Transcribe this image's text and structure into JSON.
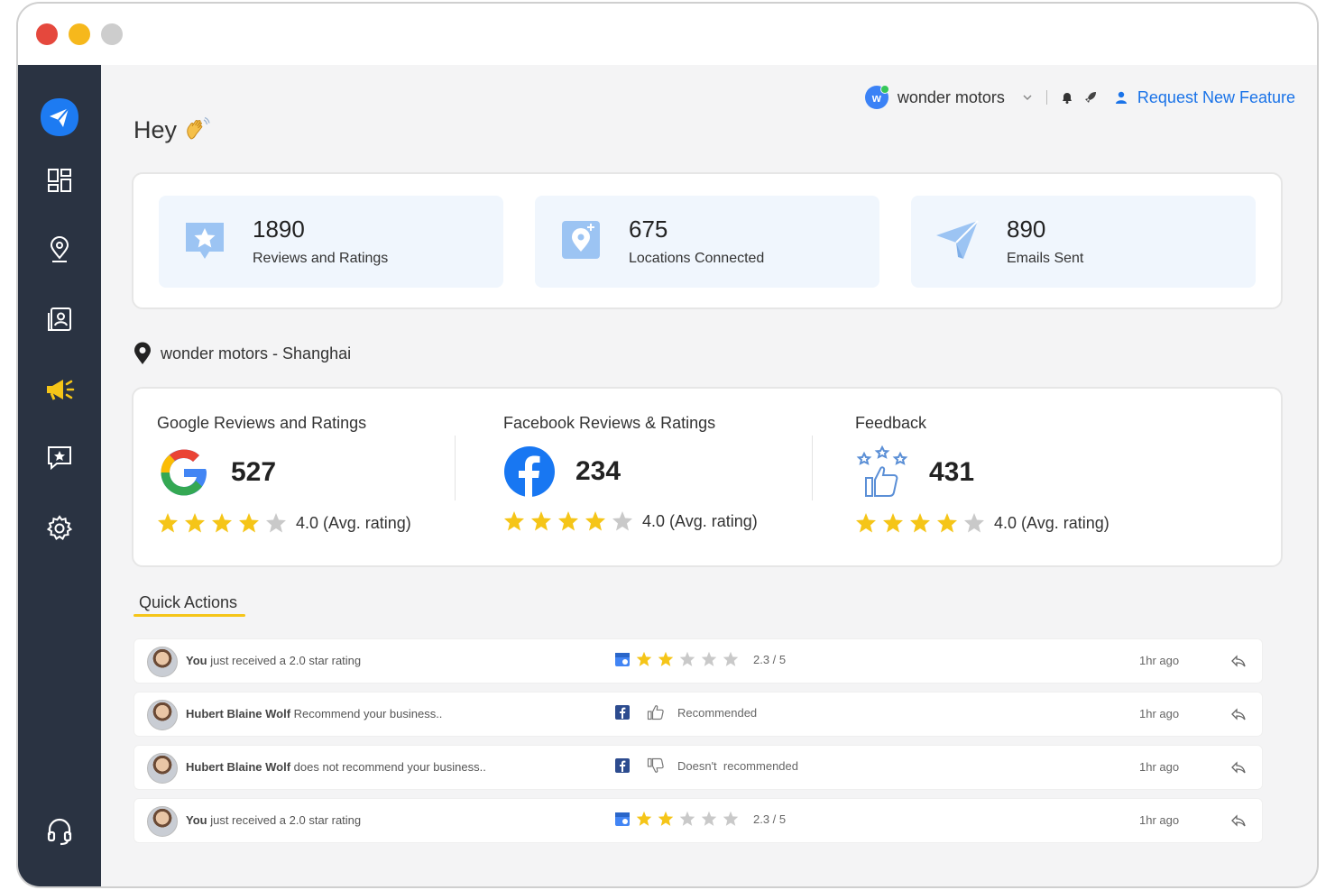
{
  "header": {
    "brand": "wonder motors",
    "request_feature": "Request New Feature"
  },
  "greeting": "Hey",
  "stats": [
    {
      "value": "1890",
      "label": "Reviews and Ratings",
      "icon": "star-badge-icon"
    },
    {
      "value": "675",
      "label": "Locations Connected",
      "icon": "location-plus-icon"
    },
    {
      "value": "890",
      "label": "Emails Sent",
      "icon": "paper-plane-icon"
    }
  ],
  "location": "wonder motors - Shanghai",
  "reviews": [
    {
      "title": "Google Reviews and Ratings",
      "count": "527",
      "rating": "4.0 (Avg. rating)",
      "stars": 4,
      "icon": "google-icon"
    },
    {
      "title": "Facebook Reviews & Ratings",
      "count": "234",
      "rating": "4.0 (Avg. rating)",
      "stars": 4,
      "icon": "facebook-icon"
    },
    {
      "title": "Feedback",
      "count": "431",
      "rating": "4.0 (Avg. rating)",
      "stars": 4,
      "icon": "thumbs-up-stars-icon"
    }
  ],
  "quick_actions": {
    "title": "Quick Actions",
    "rows": [
      {
        "name": "You",
        "text": "just received a 2.0 star rating",
        "source": "google-my-business-icon",
        "status": "2.3 / 5",
        "stars": 2,
        "time": "1hr ago"
      },
      {
        "name": "Hubert Blaine Wolf",
        "text": "Recommend your business..",
        "source": "facebook-icon",
        "status": "Recommended",
        "stars": 0,
        "time": "1hr ago"
      },
      {
        "name": "Hubert Blaine Wolf",
        "text": "does not recommend your business..",
        "source": "facebook-icon",
        "status": "Doesn't  recommended",
        "stars": 0,
        "time": "1hr ago"
      },
      {
        "name": "You",
        "text": "just received a 2.0 star rating",
        "source": "google-my-business-icon",
        "status": "2.3 / 5",
        "stars": 2,
        "time": "1hr ago"
      }
    ]
  },
  "colors": {
    "sidebar": "#2a3342",
    "accent": "#1a73e8",
    "star": "#f5c518",
    "highlight": "#f5c518"
  }
}
